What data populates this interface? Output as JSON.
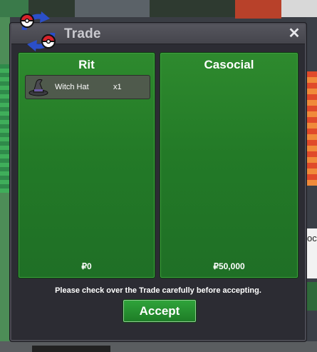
{
  "window": {
    "title": "Trade",
    "close_icon": "close-icon",
    "logo_icon": "trade-exchange-icon"
  },
  "left_panel": {
    "player_name": "Rit",
    "items": [
      {
        "name": "Witch Hat",
        "quantity": "x1",
        "icon": "witch-hat-icon"
      }
    ],
    "money": "₽0"
  },
  "right_panel": {
    "player_name": "Casocial",
    "items": [],
    "money": "₽50,000"
  },
  "notice": "Please check over the Trade carefully before accepting.",
  "accept_label": "Accept",
  "background_edge_label": "oci",
  "colors": {
    "panel_green": "#237a27",
    "window_bg": "#2c2c33",
    "accept_green": "#2fa33a"
  }
}
